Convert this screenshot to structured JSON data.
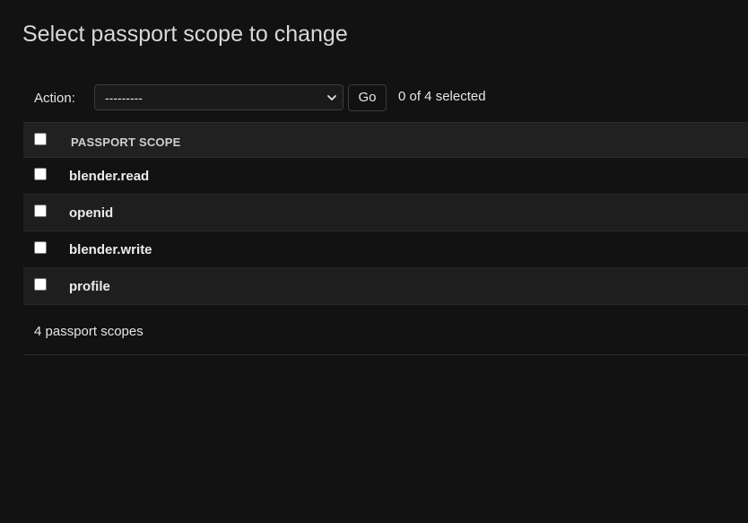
{
  "page": {
    "title": "Select passport scope to change"
  },
  "actions": {
    "label": "Action:",
    "select_value": "---------",
    "go_label": "Go",
    "selection_counter": "0 of 4 selected"
  },
  "table": {
    "column_header": "PASSPORT SCOPE",
    "rows": [
      {
        "label": "blender.read",
        "checked": false
      },
      {
        "label": "openid",
        "checked": false
      },
      {
        "label": "blender.write",
        "checked": false
      },
      {
        "label": "profile",
        "checked": false
      }
    ]
  },
  "paginator": {
    "text": "4 passport scopes"
  }
}
